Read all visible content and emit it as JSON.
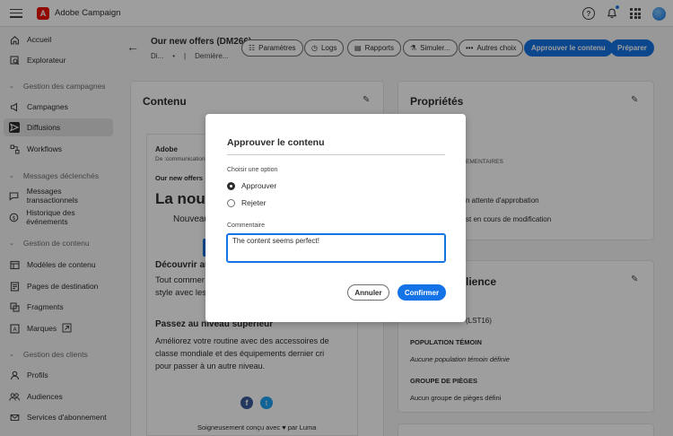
{
  "app": {
    "title": "Adobe Campaign"
  },
  "sidebar": {
    "items": [
      {
        "label": "Accueil",
        "icon": "home-icon"
      },
      {
        "label": "Explorateur",
        "icon": "explorer-icon"
      },
      {
        "section": "Gestion des campagnes"
      },
      {
        "label": "Campagnes",
        "icon": "campaign-icon"
      },
      {
        "label": "Diffusions",
        "icon": "send-icon",
        "active": true
      },
      {
        "label": "Workflows",
        "icon": "workflow-icon"
      },
      {
        "section": "Messages déclenchés"
      },
      {
        "label": "Messages transactionnels",
        "icon": "message-icon"
      },
      {
        "label": "Historique des événements",
        "icon": "history-icon"
      },
      {
        "section": "Gestion de contenu"
      },
      {
        "label": "Modèles de contenu",
        "icon": "template-icon"
      },
      {
        "label": "Pages de destination",
        "icon": "landing-page-icon"
      },
      {
        "label": "Fragments",
        "icon": "fragment-icon"
      },
      {
        "label": "Marques",
        "icon": "brand-icon"
      },
      {
        "section": "Gestion des clients"
      },
      {
        "label": "Profils",
        "icon": "profile-icon"
      },
      {
        "label": "Audiences",
        "icon": "audience-icon"
      },
      {
        "label": "Services d'abonnement",
        "icon": "subscription-icon"
      }
    ]
  },
  "header": {
    "title": "Our new offers (DM266)",
    "subtitle_a": "Di...",
    "subtitle_b": "Dernière...",
    "buttons": {
      "params": "Paramètres",
      "logs": "Logs",
      "reports": "Rapports",
      "simulate": "Simuler...",
      "more": "Autres choix",
      "approve": "Approuver le contenu",
      "prepare": "Préparer"
    }
  },
  "content_panel": {
    "title": "Contenu",
    "email": {
      "brand": "Adobe",
      "from": "De :communication",
      "subject": "Our new offers",
      "headline": "La nouv",
      "sub": "Nouveau",
      "section1_title": "Découvrir au",
      "section1_line1": "Tout commer",
      "section1_line2": "style avec les",
      "section2_title": "Passez au niveau supérieur",
      "section2_body_1": "Améliorez votre routine avec des accessoires de",
      "section2_body_2": "classe mondiale et des équipements dernier cri",
      "section2_body_3": "pour passer à un autre niveau.",
      "footer": "Soigneusement conçu avec ♥ par Luma"
    }
  },
  "properties_panel": {
    "title": "Propriétés",
    "fields": {
      "complement_label": "EMENTAIRES",
      "status_1": "n attente d'approbation",
      "status_2": "st en cours de modification"
    }
  },
  "audience_panel": {
    "title_part": "lience",
    "audience_value": "(LST16)",
    "control_label": "POPULATION TÉMOIN",
    "control_value": "Aucune population témoin définie",
    "traps_label": "GROUPE DE PIÈGES",
    "traps_value": "Aucun groupe de pièges défini"
  },
  "modal": {
    "title": "Approuver le contenu",
    "choice_label": "Choisir une option",
    "option_approve": "Approuver",
    "option_reject": "Rejeter",
    "comment_label": "Commentaire",
    "comment_value": "The content seems perfect!",
    "cancel": "Annuler",
    "confirm": "Confirmer"
  },
  "colors": {
    "accent": "#1473e6",
    "brand": "#eb1000"
  }
}
